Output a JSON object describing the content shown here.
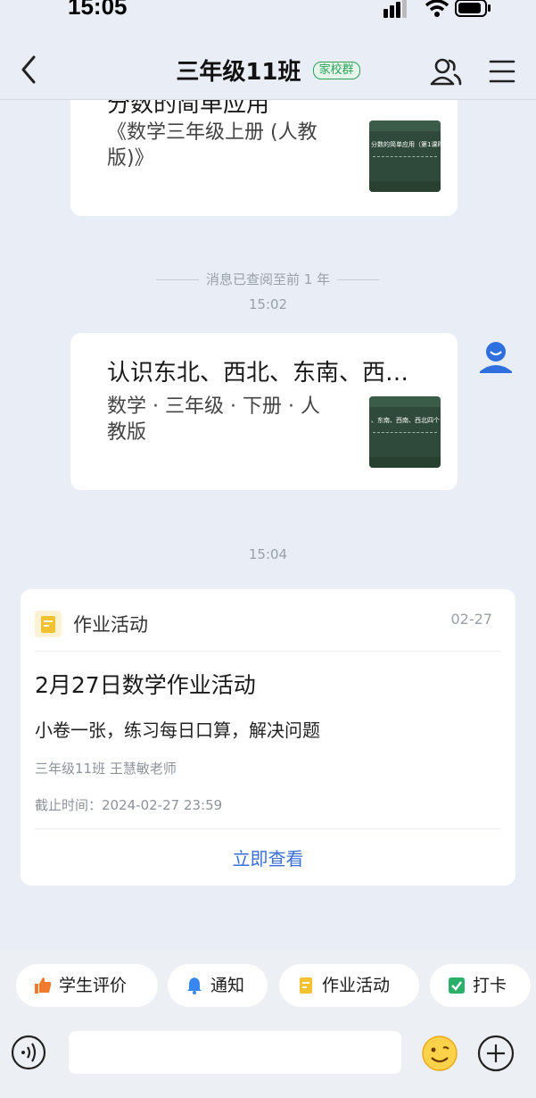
{
  "status_bar": {
    "time": "15:05"
  },
  "nav": {
    "title": "三年级11班",
    "badge": "家校群"
  },
  "messages": {
    "resource1": {
      "title_partial": "分数的简单应用",
      "subtitle": "《数学三年级上册 (人教版)》",
      "thumb_title": "分数的简单应用（第1课时）"
    },
    "history_divider": "消息已查阅至前 1 年",
    "time1": "15:02",
    "resource2": {
      "title": "认识东北、西北、东南、西…",
      "subtitle": "数学 · 三年级 · 下册 · 人教版",
      "thumb_title": "、东南、西南、西北四个"
    },
    "time2": "15:04"
  },
  "homework": {
    "type_label": "作业活动",
    "date": "02-27",
    "title": "2月27日数学作业活动",
    "description": "小卷一张，练习每日口算，解决问题",
    "class_teacher": "三年级11班  王慧敏老师",
    "deadline": "截止时间：2024-02-27 23:59",
    "view_button": "立即查看"
  },
  "quick_actions": [
    {
      "label": "学生评价",
      "icon": "thumbs-up-icon",
      "color": "#f07b2e"
    },
    {
      "label": "通知",
      "icon": "bell-icon",
      "color": "#3a86f0"
    },
    {
      "label": "作业活动",
      "icon": "homework-icon",
      "color": "#f2c230"
    },
    {
      "label": "打卡",
      "icon": "checkin-icon",
      "color": "#2bb06a"
    }
  ],
  "input": {
    "placeholder": ""
  }
}
